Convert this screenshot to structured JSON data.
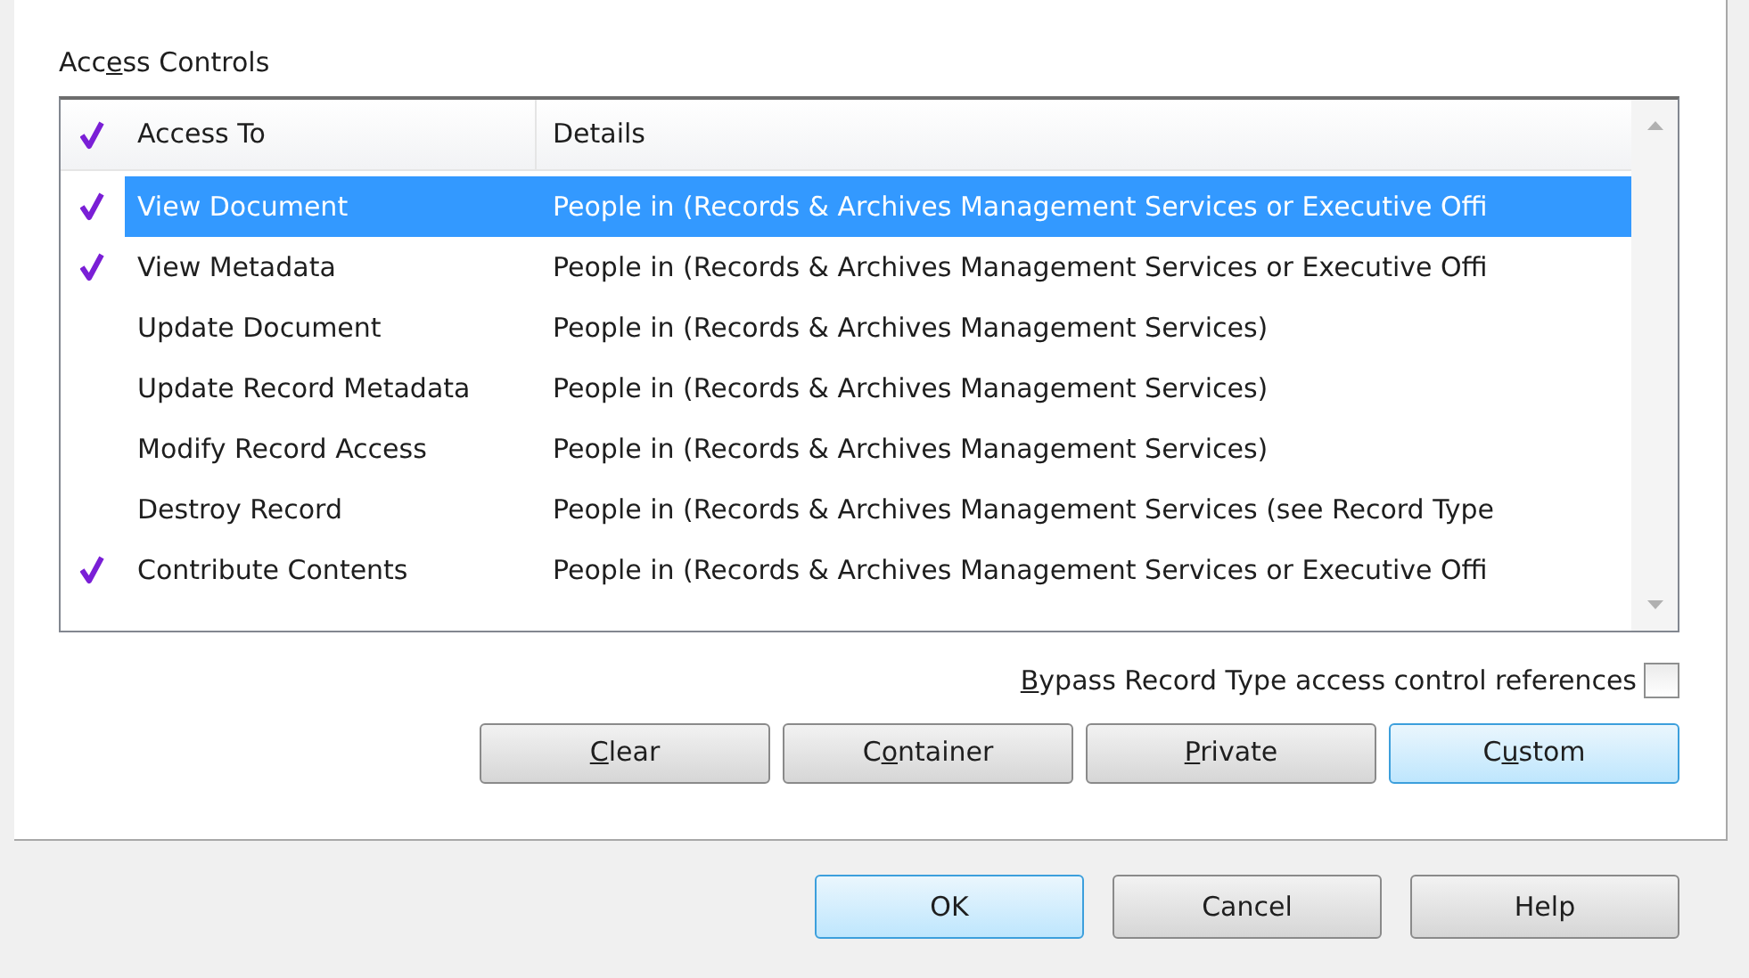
{
  "section": {
    "label": {
      "before": "Acc",
      "key": "e",
      "after": "ss Controls"
    }
  },
  "table": {
    "columns": [
      "Access To",
      "Details"
    ],
    "rows": [
      {
        "access_to": "View Document",
        "details": "People in (Records & Archives Management Services or Executive Offi",
        "checked": true,
        "selected": true
      },
      {
        "access_to": "View Metadata",
        "details": "People in (Records & Archives Management Services or Executive Offi",
        "checked": true,
        "selected": false
      },
      {
        "access_to": "Update Document",
        "details": "People in (Records & Archives Management Services)",
        "checked": false,
        "selected": false
      },
      {
        "access_to": "Update Record Metadata",
        "details": "People in (Records & Archives Management Services)",
        "checked": false,
        "selected": false
      },
      {
        "access_to": "Modify Record Access",
        "details": "People in (Records & Archives Management Services)",
        "checked": false,
        "selected": false
      },
      {
        "access_to": "Destroy Record",
        "details": "People in (Records & Archives Management Services (see Record Type",
        "checked": false,
        "selected": false
      },
      {
        "access_to": "Contribute Contents",
        "details": "People in (Records & Archives Management Services or Executive Offi",
        "checked": true,
        "selected": false
      }
    ]
  },
  "bypass": {
    "label": {
      "key": "B",
      "after": "ypass Record Type access control references"
    },
    "checked": false
  },
  "access_buttons": [
    {
      "label": {
        "key": "C",
        "after": "lear"
      },
      "selected": false
    },
    {
      "label": {
        "before": "C",
        "key": "o",
        "after": "ntainer"
      },
      "selected": false
    },
    {
      "label": {
        "key": "P",
        "after": "rivate"
      },
      "selected": false
    },
    {
      "label": {
        "before": "C",
        "key": "u",
        "after": "stom"
      },
      "selected": true
    }
  ],
  "dialog_buttons": [
    {
      "label": "OK",
      "default": true
    },
    {
      "label": "Cancel",
      "default": false
    },
    {
      "label": "Help",
      "default": false
    }
  ]
}
